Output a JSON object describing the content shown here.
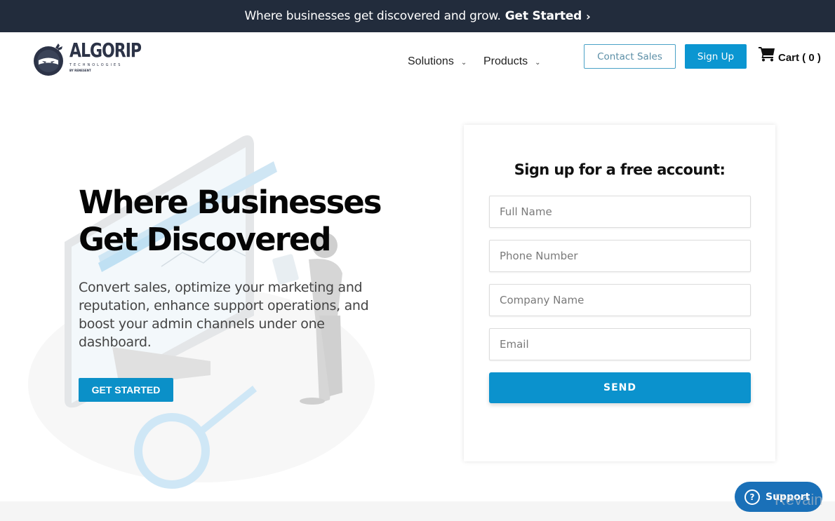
{
  "announcement": {
    "text": "Where businesses get discovered and grow.",
    "cta_label": "Get Started",
    "chevron": "›"
  },
  "header": {
    "logo": {
      "name": "ALGORIP",
      "subtitle": "TECHNOLOGIES",
      "byline": "BY RENESENT"
    },
    "nav": [
      {
        "label": "Solutions",
        "caret": "⌄"
      },
      {
        "label": "Products",
        "caret": "⌄"
      }
    ],
    "contact_sales_label": "Contact Sales",
    "sign_up_label": "Sign Up",
    "cart_label": "Cart ( 0 )",
    "cart_count": 0
  },
  "hero": {
    "title_line1": "Where Businesses",
    "title_line2": "Get Discovered",
    "description": "Convert sales, optimize your marketing and reputation, enhance support operations, and boost your admin channels under one dashboard.",
    "cta_label": "GET STARTED"
  },
  "signup_form": {
    "title": "Sign up for a free account:",
    "fields": [
      {
        "name": "full-name",
        "placeholder": "Full Name",
        "value": ""
      },
      {
        "name": "phone-number",
        "placeholder": "Phone Number",
        "value": ""
      },
      {
        "name": "company-name",
        "placeholder": "Company Name",
        "value": ""
      },
      {
        "name": "email",
        "placeholder": "Email",
        "value": ""
      }
    ],
    "submit_label": "SEND"
  },
  "support_widget": {
    "label": "Support",
    "icon": "?"
  },
  "watermark": "Revain",
  "colors": {
    "topbar_bg": "#222c3c",
    "primary": "#0b96d1",
    "support_bg": "#1a70b8"
  }
}
